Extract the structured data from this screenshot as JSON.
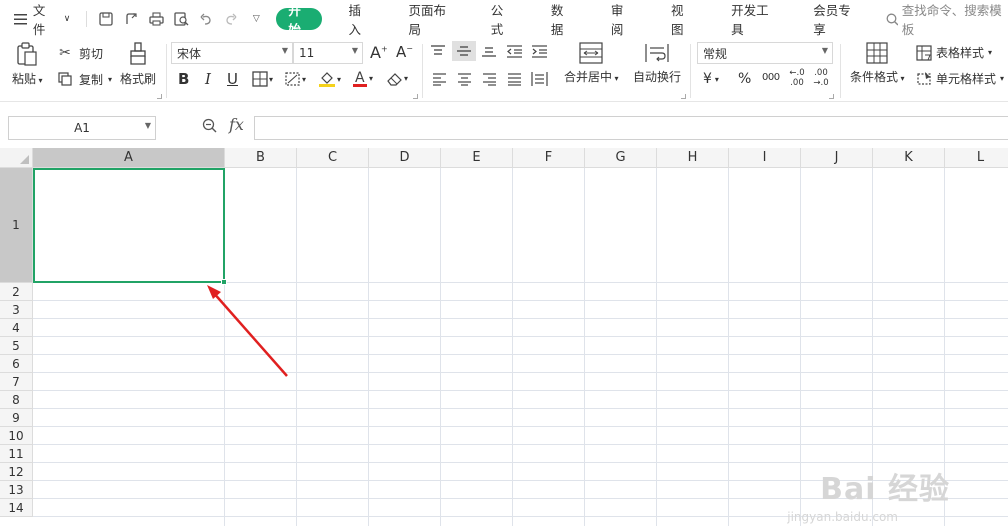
{
  "menu": {
    "file_label": "文件",
    "tabs": [
      {
        "label": "开始",
        "active": true
      },
      {
        "label": "插入"
      },
      {
        "label": "页面布局"
      },
      {
        "label": "公式"
      },
      {
        "label": "数据"
      },
      {
        "label": "审阅"
      },
      {
        "label": "视图"
      },
      {
        "label": "开发工具"
      },
      {
        "label": "会员专享"
      }
    ],
    "search_placeholder": "查找命令、搜索模板"
  },
  "ribbon": {
    "paste": "粘贴",
    "cut": "剪切",
    "copy": "复制",
    "format_painter": "格式刷",
    "font_name": "宋体",
    "font_size": "11",
    "bold": "B",
    "italic": "I",
    "underline": "U",
    "merge_center": "合并居中",
    "wrap_text": "自动换行",
    "number_format": "常规",
    "currency": "¥",
    "percent": "%",
    "thousands": "000",
    "dec_increase": "←.0 .00",
    "dec_decrease": ".00 →.0",
    "conditional_format": "条件格式",
    "table_style": "表格样式",
    "cell_style": "单元格样式"
  },
  "formula_bar": {
    "cell_ref": "A1",
    "fx_label": "fx",
    "formula": ""
  },
  "sheet": {
    "columns": [
      "A",
      "B",
      "C",
      "D",
      "E",
      "F",
      "G",
      "H",
      "I",
      "J",
      "K",
      "L"
    ],
    "rows": [
      "1",
      "2",
      "3",
      "4",
      "5",
      "6",
      "7",
      "8",
      "9",
      "10",
      "11",
      "12",
      "13",
      "14"
    ],
    "selected_cell": "A1"
  },
  "watermark": {
    "main": "Bai 经验",
    "sub": "jingyan.baidu.com"
  },
  "colors": {
    "accent": "#1aad72",
    "selection": "#21a366",
    "arrow": "#e02020"
  }
}
